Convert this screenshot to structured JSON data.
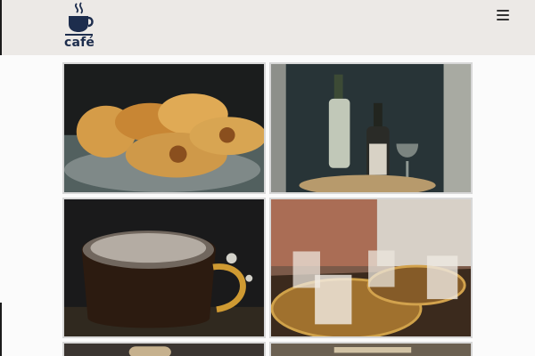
{
  "header": {
    "logo_text": "café",
    "logo_icon": "coffee-cup-icon",
    "menu_icon": "hamburger-menu-icon"
  },
  "gallery": {
    "tiles": [
      {
        "subject": "pastries",
        "icon": "croissant-photo"
      },
      {
        "subject": "wine",
        "icon": "wine-bottles-photo"
      },
      {
        "subject": "coffee",
        "icon": "coffee-mug-photo"
      },
      {
        "subject": "glasses",
        "icon": "water-glasses-photo"
      },
      {
        "subject": "partial-row-left",
        "icon": "photo"
      },
      {
        "subject": "partial-row-right",
        "icon": "photo"
      }
    ]
  },
  "colors": {
    "header_bg": "#ece9e6",
    "logo_navy": "#1d2d4d",
    "page_bg": "#fbfbfb"
  }
}
